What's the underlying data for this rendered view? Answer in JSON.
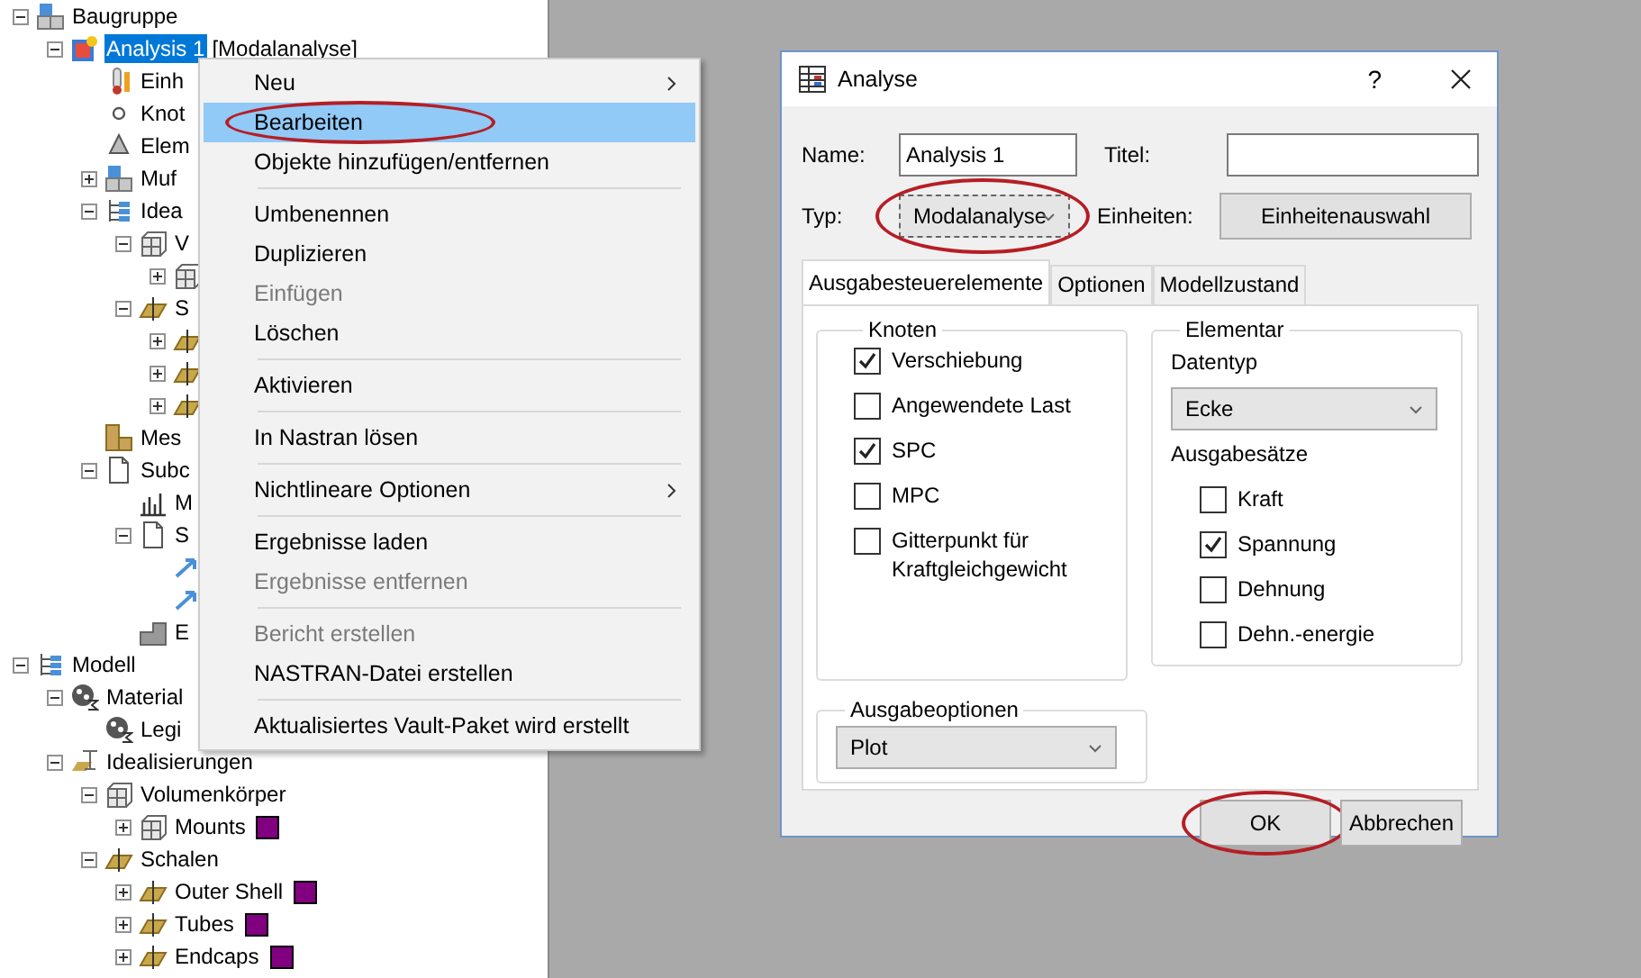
{
  "tree": [
    {
      "label": "Baugruppe",
      "kind": "assembly",
      "expanded": true,
      "selected": false,
      "children": [
        {
          "label": "Analysis 1",
          "suffix": "[Modalanalyse]",
          "kind": "analysis",
          "expanded": true,
          "selected": true,
          "children": [
            {
              "label": "Einh",
              "kind": "thermometer",
              "selected": false
            },
            {
              "label": "Knot",
              "kind": "node",
              "selected": false
            },
            {
              "label": "Elem",
              "kind": "element",
              "selected": false
            },
            {
              "label": "Muf",
              "kind": "assembly",
              "expanded": false,
              "selected": false
            },
            {
              "label": "Idea",
              "kind": "hierarchy",
              "expanded": true,
              "selected": false,
              "children": [
                {
                  "label": "V",
                  "kind": "cubes",
                  "expanded": true,
                  "selected": false,
                  "children": [
                    {
                      "kind": "cubes",
                      "expanded": false,
                      "selected": false
                    }
                  ]
                },
                {
                  "label": "S",
                  "kind": "shell",
                  "expanded": true,
                  "selected": false,
                  "children": [
                    {
                      "kind": "shell",
                      "expanded": false,
                      "selected": false
                    },
                    {
                      "kind": "shell",
                      "expanded": false,
                      "selected": false
                    },
                    {
                      "kind": "shell",
                      "expanded": false,
                      "selected": false
                    }
                  ]
                }
              ]
            },
            {
              "label": "Mes",
              "kind": "mesh",
              "selected": false
            },
            {
              "label": "Subc",
              "kind": "document",
              "expanded": true,
              "selected": false,
              "children": [
                {
                  "label": "M",
                  "kind": "chart",
                  "selected": false
                },
                {
                  "label": "S",
                  "kind": "document",
                  "expanded": true,
                  "selected": false,
                  "children": [
                    {
                      "kind": "arrow",
                      "selected": false
                    },
                    {
                      "kind": "arrow",
                      "selected": false
                    }
                  ]
                },
                {
                  "label": "E",
                  "kind": "part",
                  "selected": false
                }
              ]
            }
          ]
        }
      ]
    },
    {
      "label": "Modell",
      "kind": "hierarchy",
      "expanded": true,
      "selected": false,
      "children": [
        {
          "label": "Material",
          "kind": "material",
          "expanded": true,
          "selected": false,
          "children": [
            {
              "label": "Legi",
              "kind": "material",
              "selected": false
            }
          ]
        },
        {
          "label": "Idealisierungen",
          "kind": "idealization",
          "expanded": true,
          "selected": false,
          "children": [
            {
              "label": "Volumenkörper",
              "kind": "cubes",
              "expanded": true,
              "selected": false,
              "children": [
                {
                  "label": "Mounts",
                  "kind": "cubes",
                  "expanded": false,
                  "selected": false,
                  "color": "#800080"
                }
              ]
            },
            {
              "label": "Schalen",
              "kind": "shell",
              "expanded": true,
              "selected": false,
              "children": [
                {
                  "label": "Outer Shell",
                  "kind": "shell",
                  "expanded": false,
                  "selected": false,
                  "color": "#800080"
                },
                {
                  "label": "Tubes",
                  "kind": "shell",
                  "expanded": false,
                  "selected": false,
                  "color": "#800080"
                },
                {
                  "label": "Endcaps",
                  "kind": "shell",
                  "expanded": false,
                  "selected": false,
                  "color": "#800080"
                }
              ]
            }
          ]
        }
      ]
    }
  ],
  "context_menu": {
    "groups": [
      {
        "items": [
          {
            "label": "Neu",
            "submenu": true,
            "disabled": false,
            "selected": false,
            "circled": false
          },
          {
            "label": "Bearbeiten",
            "submenu": false,
            "disabled": false,
            "selected": true,
            "circled": true
          },
          {
            "label": "Objekte hinzufügen/entfernen",
            "submenu": false,
            "disabled": false,
            "selected": false,
            "circled": false
          }
        ]
      },
      {
        "items": [
          {
            "label": "Umbenennen",
            "submenu": false,
            "disabled": false,
            "selected": false,
            "circled": false
          },
          {
            "label": "Duplizieren",
            "submenu": false,
            "disabled": false,
            "selected": false,
            "circled": false
          },
          {
            "label": "Einfügen",
            "submenu": false,
            "disabled": true,
            "selected": false,
            "circled": false
          },
          {
            "label": "Löschen",
            "submenu": false,
            "disabled": false,
            "selected": false,
            "circled": false
          }
        ]
      },
      {
        "items": [
          {
            "label": "Aktivieren",
            "submenu": false,
            "disabled": false,
            "selected": false,
            "circled": false
          }
        ]
      },
      {
        "items": [
          {
            "label": "In Nastran lösen",
            "submenu": false,
            "disabled": false,
            "selected": false,
            "circled": false
          }
        ]
      },
      {
        "items": [
          {
            "label": "Nichtlineare Optionen",
            "submenu": true,
            "disabled": false,
            "selected": false,
            "circled": false
          }
        ]
      },
      {
        "items": [
          {
            "label": "Ergebnisse laden",
            "submenu": false,
            "disabled": false,
            "selected": false,
            "circled": false
          },
          {
            "label": "Ergebnisse entfernen",
            "submenu": false,
            "disabled": true,
            "selected": false,
            "circled": false
          }
        ]
      },
      {
        "items": [
          {
            "label": "Bericht erstellen",
            "submenu": false,
            "disabled": true,
            "selected": false,
            "circled": false
          },
          {
            "label": "NASTRAN-Datei erstellen",
            "submenu": false,
            "disabled": false,
            "selected": false,
            "circled": false
          }
        ]
      },
      {
        "items": [
          {
            "label": "Aktualisiertes Vault-Paket wird erstellt",
            "submenu": false,
            "disabled": false,
            "selected": false,
            "circled": false
          }
        ]
      }
    ]
  },
  "dialog": {
    "title": "Analyse",
    "help": "?",
    "name": {
      "label": "Name:",
      "value": "Analysis 1"
    },
    "titel": {
      "label": "Titel:"
    },
    "typ": {
      "label": "Typ:",
      "value": "Modalanalyse",
      "circled": true
    },
    "einheiten": {
      "label": "Einheiten:",
      "button": "Einheitenauswahl"
    },
    "tabs": [
      {
        "label": "Ausgabesteuerelemente",
        "selected": true
      },
      {
        "label": "Optionen",
        "selected": false
      },
      {
        "label": "Modellzustand",
        "selected": false
      }
    ],
    "knoten": {
      "title": "Knoten",
      "items": [
        {
          "label": "Verschiebung",
          "checked": true
        },
        {
          "label": "Angewendete Last",
          "checked": false
        },
        {
          "label": "SPC",
          "checked": true
        },
        {
          "label": "MPC",
          "checked": false
        },
        {
          "label": "Gitterpunkt für Kraftgleichgewicht",
          "checked": false
        }
      ]
    },
    "elementar": {
      "title": "Elementar",
      "datentyp_label": "Datentyp",
      "datentyp": "Ecke",
      "saetze_label": "Ausgabesätze",
      "items": [
        {
          "label": "Kraft",
          "checked": false
        },
        {
          "label": "Spannung",
          "checked": true
        },
        {
          "label": "Dehnung",
          "checked": false
        },
        {
          "label": "Dehn.-energie",
          "checked": false
        }
      ]
    },
    "ausgabeoptionen": {
      "title": "Ausgabeoptionen",
      "value": "Plot"
    },
    "buttons": [
      {
        "label": "OK",
        "circled": true
      },
      {
        "label": "Abbrechen",
        "circled": false
      }
    ]
  }
}
